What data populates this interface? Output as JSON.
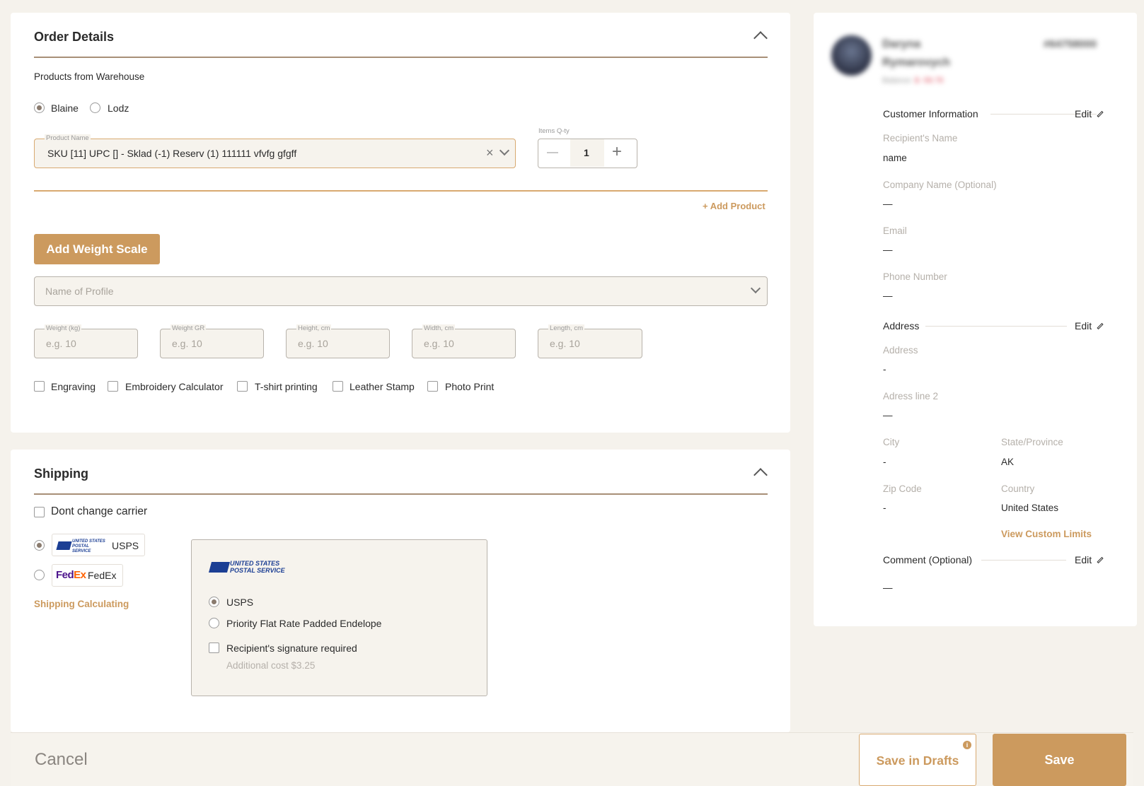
{
  "order": {
    "title": "Order Details",
    "products_label": "Products from Warehouse",
    "warehouses": [
      {
        "label": "Blaine",
        "selected": true
      },
      {
        "label": "Lodz",
        "selected": false
      }
    ],
    "product_field": {
      "legend": "Product Name",
      "value": "SKU [11] UPC [] - Sklad (-1) Reserv (1) 111111 vfvfg gfgff"
    },
    "qty": {
      "legend": "Items Q-ty",
      "value": "1",
      "minus": "—",
      "plus": "+"
    },
    "add_product": "+ Add Product",
    "add_weight_scale": "Add Weight Scale",
    "profile_placeholder": "Name of Profile",
    "dims": [
      {
        "legend": "Weight (kg)",
        "placeholder": "e.g. 10"
      },
      {
        "legend": "Weight GR",
        "placeholder": "e.g. 10"
      },
      {
        "legend": "Height, cm",
        "placeholder": "e.g. 10"
      },
      {
        "legend": "Width, cm",
        "placeholder": "e.g. 10"
      },
      {
        "legend": "Length, cm",
        "placeholder": "e.g. 10"
      }
    ],
    "options": [
      "Engraving",
      "Embroidery Calculator",
      "T-shirt printing",
      "Leather Stamp",
      "Photo Print"
    ]
  },
  "shipping": {
    "title": "Shipping",
    "dont_change": "Dont change carrier",
    "carriers": [
      {
        "label": "USPS",
        "logo": "UNITED STATES POSTAL SERVICE",
        "selected": true
      },
      {
        "label": "FedEx",
        "logo_a": "Fed",
        "logo_b": "Ex",
        "selected": false
      }
    ],
    "calc_link": "Shipping Calculating",
    "panel": {
      "logo_line1": "UNITED STATES",
      "logo_line2": "POSTAL SERVICE",
      "services": [
        {
          "label": "USPS",
          "selected": true
        },
        {
          "label": "Priority Flat Rate Padded Endelope",
          "selected": false
        }
      ],
      "signature": "Recipient's signature required",
      "signature_cost": "Additional cost $3.25"
    }
  },
  "customer": {
    "name_line1": "Daryna",
    "name_line2": "Rymarovych",
    "id": "#64758000",
    "balance_label": "Balance:",
    "balance_value": "$ -58.78",
    "info_title": "Customer Information",
    "edit": "Edit",
    "recipient_label": "Recipient's Name",
    "recipient_value": "name",
    "company_label": "Company Name (Optional)",
    "company_value": "—",
    "email_label": "Email",
    "email_value": "—",
    "phone_label": "Phone Number",
    "phone_value": "—",
    "address_title": "Address",
    "address_label": "Address",
    "address_value": "-",
    "address2_label": "Adress line 2",
    "address2_value": "—",
    "city_label": "City",
    "city_value": "-",
    "state_label": "State/Province",
    "state_value": "AK",
    "zip_label": "Zip Code",
    "zip_value": "-",
    "country_label": "Country",
    "country_value": "United States",
    "custom_limits": "View Custom Limits",
    "comment_title": "Comment (Optional)",
    "comment_value": "—"
  },
  "footer": {
    "cancel": "Cancel",
    "save_drafts": "Save in Drafts",
    "save": "Save"
  },
  "colors": {
    "accent": "#cc9a5e",
    "divider": "#a88f77",
    "background": "#f5f2ec"
  }
}
